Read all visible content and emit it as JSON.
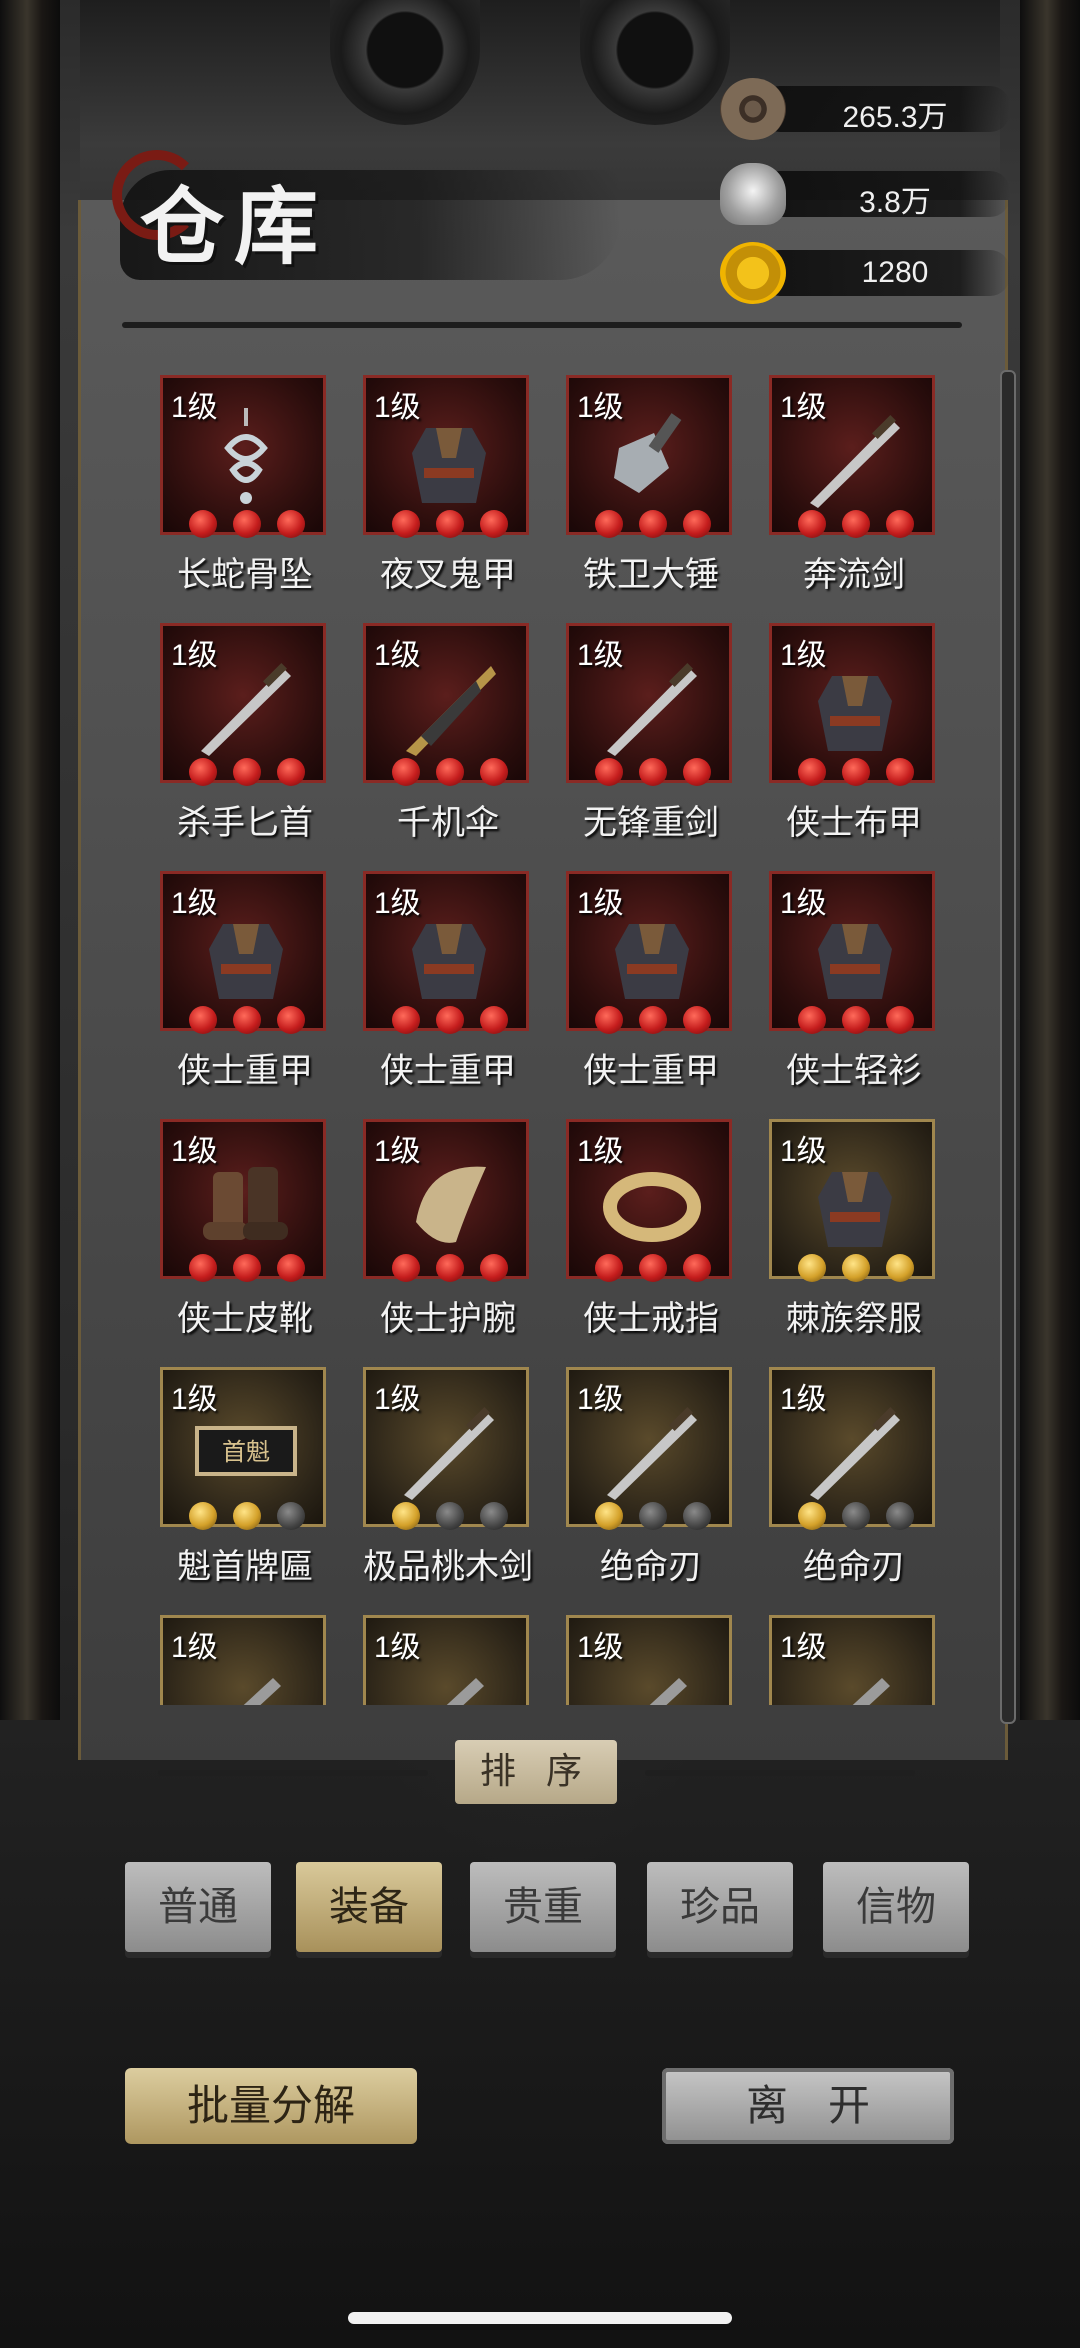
{
  "screen": {
    "title": "仓库"
  },
  "currencies": [
    {
      "icon": "copper-coin-icon",
      "value": "265.3万"
    },
    {
      "icon": "silver-ingot-icon",
      "value": "3.8万"
    },
    {
      "icon": "gold-coin-icon",
      "value": "1280"
    }
  ],
  "items": [
    {
      "level": "1级",
      "name": "长蛇骨坠",
      "rarity": "red",
      "stars": 3
    },
    {
      "level": "1级",
      "name": "夜叉鬼甲",
      "rarity": "red",
      "stars": 3
    },
    {
      "level": "1级",
      "name": "铁卫大锤",
      "rarity": "red",
      "stars": 3
    },
    {
      "level": "1级",
      "name": "奔流剑",
      "rarity": "red",
      "stars": 3
    },
    {
      "level": "1级",
      "name": "杀手匕首",
      "rarity": "red",
      "stars": 3
    },
    {
      "level": "1级",
      "name": "千机伞",
      "rarity": "red",
      "stars": 3
    },
    {
      "level": "1级",
      "name": "无锋重剑",
      "rarity": "red",
      "stars": 3
    },
    {
      "level": "1级",
      "name": "侠士布甲",
      "rarity": "red",
      "stars": 3
    },
    {
      "level": "1级",
      "name": "侠士重甲",
      "rarity": "red",
      "stars": 3
    },
    {
      "level": "1级",
      "name": "侠士重甲",
      "rarity": "red",
      "stars": 3
    },
    {
      "level": "1级",
      "name": "侠士重甲",
      "rarity": "red",
      "stars": 3
    },
    {
      "level": "1级",
      "name": "侠士轻衫",
      "rarity": "red",
      "stars": 3
    },
    {
      "level": "1级",
      "name": "侠士皮靴",
      "rarity": "red",
      "stars": 3
    },
    {
      "level": "1级",
      "name": "侠士护腕",
      "rarity": "red",
      "stars": 3
    },
    {
      "level": "1级",
      "name": "侠士戒指",
      "rarity": "red",
      "stars": 3
    },
    {
      "level": "1级",
      "name": "棘族祭服",
      "rarity": "gold",
      "stars": 3
    },
    {
      "level": "1级",
      "name": "魁首牌匾",
      "rarity": "gold",
      "stars": 2
    },
    {
      "level": "1级",
      "name": "极品桃木剑",
      "rarity": "gold",
      "stars": 1
    },
    {
      "level": "1级",
      "name": "绝命刃",
      "rarity": "gold",
      "stars": 1
    },
    {
      "level": "1级",
      "name": "绝命刃",
      "rarity": "gold",
      "stars": 1
    },
    {
      "level": "1级",
      "name": "",
      "rarity": "gold",
      "stars": 0
    },
    {
      "level": "1级",
      "name": "",
      "rarity": "gold",
      "stars": 0
    },
    {
      "level": "1级",
      "name": "",
      "rarity": "gold",
      "stars": 0
    },
    {
      "level": "1级",
      "name": "",
      "rarity": "gold",
      "stars": 0
    }
  ],
  "plaque_text": "首魁",
  "sort": {
    "label": "排序"
  },
  "categories": [
    {
      "label": "普通",
      "active": false
    },
    {
      "label": "装备",
      "active": true
    },
    {
      "label": "贵重",
      "active": false
    },
    {
      "label": "珍品",
      "active": false
    },
    {
      "label": "信物",
      "active": false
    }
  ],
  "actions": {
    "decompose": "批量分解",
    "leave": "离开"
  }
}
